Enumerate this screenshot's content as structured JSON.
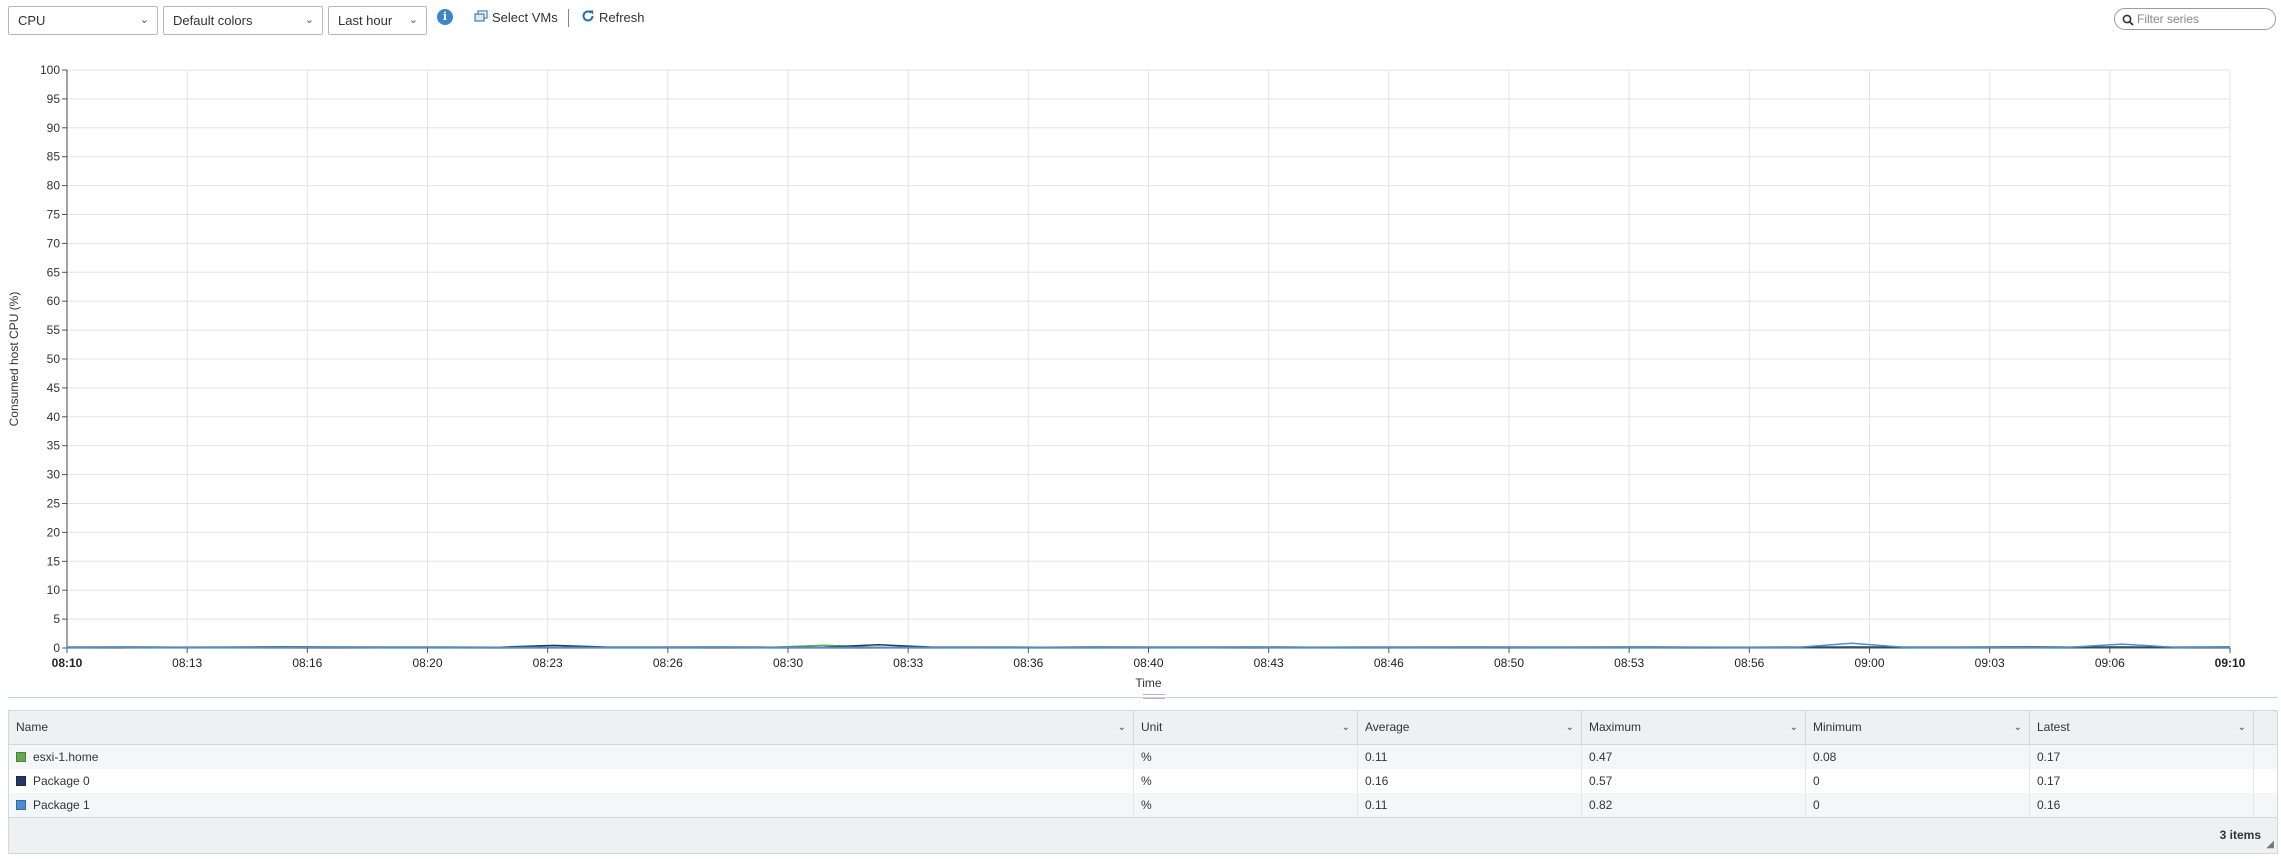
{
  "toolbar": {
    "metric_select": "CPU",
    "colors_select": "Default colors",
    "period_select": "Last hour",
    "select_vms_label": "Select VMs",
    "refresh_label": "Refresh",
    "filter_placeholder": "Filter series"
  },
  "chart_data": {
    "type": "line",
    "ylabel": "Consumed host CPU (%)",
    "xlabel": "Time",
    "ylim": [
      0,
      100
    ],
    "y_ticks": [
      0,
      5,
      10,
      15,
      20,
      25,
      30,
      35,
      40,
      45,
      50,
      55,
      60,
      65,
      70,
      75,
      80,
      85,
      90,
      95,
      100
    ],
    "x_ticks": [
      "08:10",
      "08:13",
      "08:16",
      "08:20",
      "08:23",
      "08:26",
      "08:30",
      "08:33",
      "08:36",
      "08:40",
      "08:43",
      "08:46",
      "08:50",
      "08:53",
      "08:56",
      "09:00",
      "09:03",
      "09:06",
      "09:10"
    ],
    "x_tick_bold": [
      "08:10",
      "09:10"
    ],
    "grid": true,
    "series": [
      {
        "name": "esxi-1.home",
        "color": "#6aa84f",
        "values": [
          0.11,
          0.12,
          0.1,
          0.09,
          0.12,
          0.14,
          0.1,
          0.11,
          0.13,
          0.12,
          0.1,
          0.11,
          0.12,
          0.1,
          0.47,
          0.11,
          0.12,
          0.1,
          0.11,
          0.12,
          0.1,
          0.08,
          0.12,
          0.11,
          0.13,
          0.1,
          0.11,
          0.12,
          0.1,
          0.11,
          0.12,
          0.1,
          0.11,
          0.13,
          0.12,
          0.1,
          0.11,
          0.12,
          0.1,
          0.11,
          0.17
        ]
      },
      {
        "name": "Package 0",
        "color": "#1f3b66",
        "values": [
          0.15,
          0.17,
          0.14,
          0.16,
          0.2,
          0.18,
          0.15,
          0.16,
          0.14,
          0.45,
          0.16,
          0.15,
          0.17,
          0.14,
          0.16,
          0.57,
          0.15,
          0.16,
          0.14,
          0.18,
          0.16,
          0.15,
          0.17,
          0.14,
          0.16,
          0.15,
          0.18,
          0.16,
          0.15,
          0.17,
          0.16,
          0.14,
          0.15,
          0.17,
          0.16,
          0.15,
          0.2,
          0.16,
          0.18,
          0.15,
          0.17
        ]
      },
      {
        "name": "Package 1",
        "color": "#4a8fd1",
        "values": [
          0.1,
          0.12,
          0.09,
          0.11,
          0.1,
          0.13,
          0.1,
          0.11,
          0.12,
          0.1,
          0.11,
          0.1,
          0.12,
          0.11,
          0.1,
          0.12,
          0.11,
          0.1,
          0.12,
          0.11,
          0.1,
          0.11,
          0.12,
          0.1,
          0.11,
          0.1,
          0.12,
          0.11,
          0.1,
          0.11,
          0.12,
          0.1,
          0.11,
          0.82,
          0.1,
          0.11,
          0.12,
          0.1,
          0.68,
          0.11,
          0.16
        ]
      }
    ]
  },
  "table": {
    "columns": [
      "Name",
      "Unit",
      "Average",
      "Maximum",
      "Minimum",
      "Latest"
    ],
    "rows": [
      {
        "name": "esxi-1.home",
        "color": "#6aa84f",
        "unit": "%",
        "average": "0.11",
        "maximum": "0.47",
        "minimum": "0.08",
        "latest": "0.17"
      },
      {
        "name": "Package 0",
        "color": "#1f3b66",
        "unit": "%",
        "average": "0.16",
        "maximum": "0.57",
        "minimum": "0",
        "latest": "0.17"
      },
      {
        "name": "Package 1",
        "color": "#4a8fd1",
        "unit": "%",
        "average": "0.11",
        "maximum": "0.82",
        "minimum": "0",
        "latest": "0.16"
      }
    ],
    "footer_count": "3 items"
  }
}
